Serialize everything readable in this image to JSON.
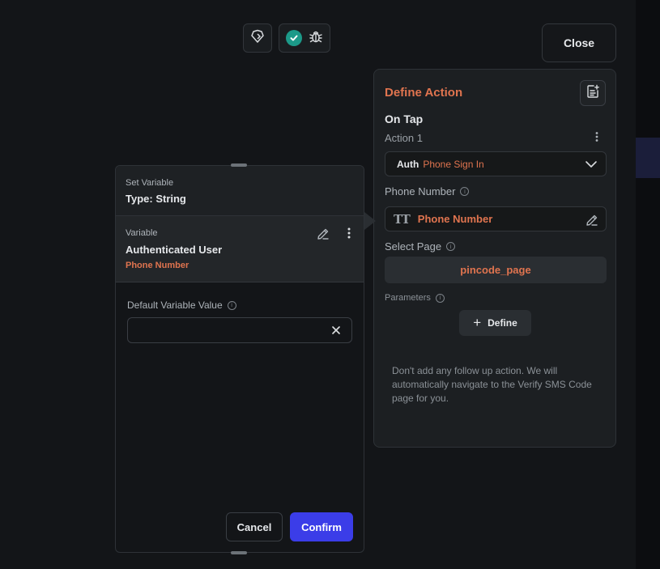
{
  "toolbar": {
    "close_label": "Close"
  },
  "action_panel": {
    "title": "Define Action",
    "trigger": "On Tap",
    "action_name": "Action 1",
    "auth_label": "Auth",
    "auth_value": "Phone Sign In",
    "phone_number_label": "Phone Number",
    "phone_number_value": "Phone Number",
    "select_page_label": "Select Page",
    "select_page_value": "pincode_page",
    "parameters_label": "Parameters",
    "define_label": "Define",
    "note": "Don't add any follow up action. We will automatically navigate to the Verify SMS Code page for you."
  },
  "variable_panel": {
    "header_sub": "Set Variable",
    "header_main": "Type: String",
    "variable_sub": "Variable",
    "variable_main": "Authenticated User",
    "variable_field": "Phone Number",
    "default_value_label": "Default Variable Value",
    "default_value": "",
    "cancel_label": "Cancel",
    "confirm_label": "Confirm"
  },
  "colors": {
    "accent": "#e0744f",
    "primary_button": "#3b3de8",
    "success": "#1c9a89"
  },
  "icons": [
    "widget-icon",
    "check-circle-icon",
    "bug-icon",
    "document-add-icon",
    "more-vertical-icon",
    "chevron-down-icon",
    "info-icon",
    "text-type-icon",
    "edit-pencil-icon",
    "plus-icon",
    "clear-x-icon"
  ]
}
